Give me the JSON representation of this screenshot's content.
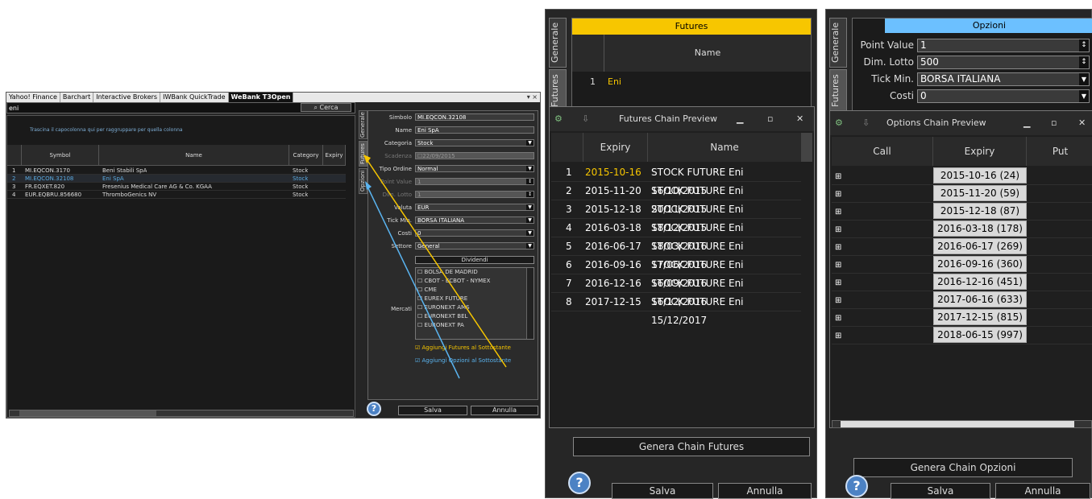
{
  "w1": {
    "tabs": [
      "Yahoo! Finance",
      "Barchart",
      "Interactive Brokers",
      "IWBank QuickTrade",
      "WeBank T3Open"
    ],
    "win_ctrl": "▾ ×",
    "search_value": "eni",
    "search_btn": "Cerca",
    "group_hint": "Trascina il capocolonna qui per raggruppare per quella colonna",
    "columns": [
      "Symbol",
      "Name",
      "Category",
      "Expiry"
    ],
    "rows": [
      {
        "n": "1",
        "symbol": "MI.EQCON.3170",
        "name": "Beni Stabili SpA",
        "cat": "Stock"
      },
      {
        "n": "2",
        "symbol": "MI.EQCON.32108",
        "name": "Eni SpA",
        "cat": "Stock"
      },
      {
        "n": "3",
        "symbol": "FR.EQXET.820",
        "name": "Fresenius Medical Care AG & Co. KGAA",
        "cat": "Stock"
      },
      {
        "n": "4",
        "symbol": "EUR.EQBRU.856680",
        "name": "ThromboGenics NV",
        "cat": "Stock"
      }
    ],
    "side_tabs": [
      "Generale",
      "Futures",
      "Opzioni"
    ],
    "form": {
      "simbolo_l": "Simbolo",
      "simbolo": "MI.EQCON.32108",
      "name_l": "Name",
      "name": "Eni SpA",
      "categoria_l": "Categoria",
      "categoria": "Stock",
      "scadenza_l": "Scadenza",
      "scadenza": "22/09/2015",
      "tipo_l": "Tipo Ordine",
      "tipo": "Normal",
      "pv_l": "Point Value",
      "pv": "1",
      "lotto_l": "Dim. Lotto",
      "lotto": "1",
      "valuta_l": "Valuta",
      "valuta": "EUR",
      "tick_l": "Tick Min.",
      "tick": "BORSA ITALIANA",
      "costi_l": "Costi",
      "costi": "0",
      "settore_l": "Settore",
      "settore": "General",
      "dividendi": "Dividendi",
      "mercati_l": "Mercati",
      "mercati": [
        "BOLSA DE MADRID",
        "CBOT - ECBOT - NYMEX",
        "CME",
        "EUREX FUTURE",
        "EURONEXT AMS",
        "EURONEXT BEL",
        "EURONEXT PA"
      ],
      "add_fut": "Aggiungi Futures al Sottostante",
      "add_opt": "Aggiungi Opzioni al Sottostante"
    },
    "salva": "Salva",
    "annulla": "Annulla",
    "help": "?"
  },
  "w2": {
    "tabs": [
      "Generale",
      "Futures"
    ],
    "header": "Futures",
    "name_col": "Name",
    "row_n": "1",
    "row_name": "Eni",
    "popup_title": "Futures Chain Preview",
    "popup_cols": [
      "Expiry",
      "Name"
    ],
    "popup_rows": [
      {
        "n": "1",
        "exp": "2015-10-16",
        "name": "STOCK FUTURE Eni 16/10/2015"
      },
      {
        "n": "2",
        "exp": "2015-11-20",
        "name": "STOCK FUTURE Eni 20/11/2015"
      },
      {
        "n": "3",
        "exp": "2015-12-18",
        "name": "STOCK FUTURE Eni 18/12/2015"
      },
      {
        "n": "4",
        "exp": "2016-03-18",
        "name": "STOCK FUTURE Eni 18/03/2016"
      },
      {
        "n": "5",
        "exp": "2016-06-17",
        "name": "STOCK FUTURE Eni 17/06/2016"
      },
      {
        "n": "6",
        "exp": "2016-09-16",
        "name": "STOCK FUTURE Eni 16/09/2016"
      },
      {
        "n": "7",
        "exp": "2016-12-16",
        "name": "STOCK FUTURE Eni 16/12/2016"
      },
      {
        "n": "8",
        "exp": "2017-12-15",
        "name": "STOCK FUTURE Eni 15/12/2017"
      }
    ],
    "genera": "Genera Chain Futures",
    "salva": "Salva",
    "annulla": "Annulla",
    "help": "?"
  },
  "w3": {
    "tabs": [
      "Generale",
      "Futures"
    ],
    "header": "Opzioni",
    "pv_l": "Point Value",
    "pv": "1",
    "lotto_l": "Dim. Lotto",
    "lotto": "500",
    "tick_l": "Tick Min.",
    "tick": "BORSA ITALIANA",
    "costi_l": "Costi",
    "costi": "0",
    "popup_title": "Options Chain Preview",
    "cols": [
      "Call",
      "Expiry",
      "Put"
    ],
    "rows": [
      "2015-10-16 (24)",
      "2015-11-20 (59)",
      "2015-12-18 (87)",
      "2016-03-18 (178)",
      "2016-06-17 (269)",
      "2016-09-16 (360)",
      "2016-12-16 (451)",
      "2017-06-16 (633)",
      "2017-12-15 (815)",
      "2018-06-15 (997)"
    ],
    "genera": "Genera Chain Opzioni",
    "salva": "Salva",
    "annulla": "Annulla",
    "help": "?"
  },
  "colors": {
    "accent_yellow": "#f7c600",
    "accent_blue": "#5ab4f0",
    "future_exp": "#f7c600"
  }
}
